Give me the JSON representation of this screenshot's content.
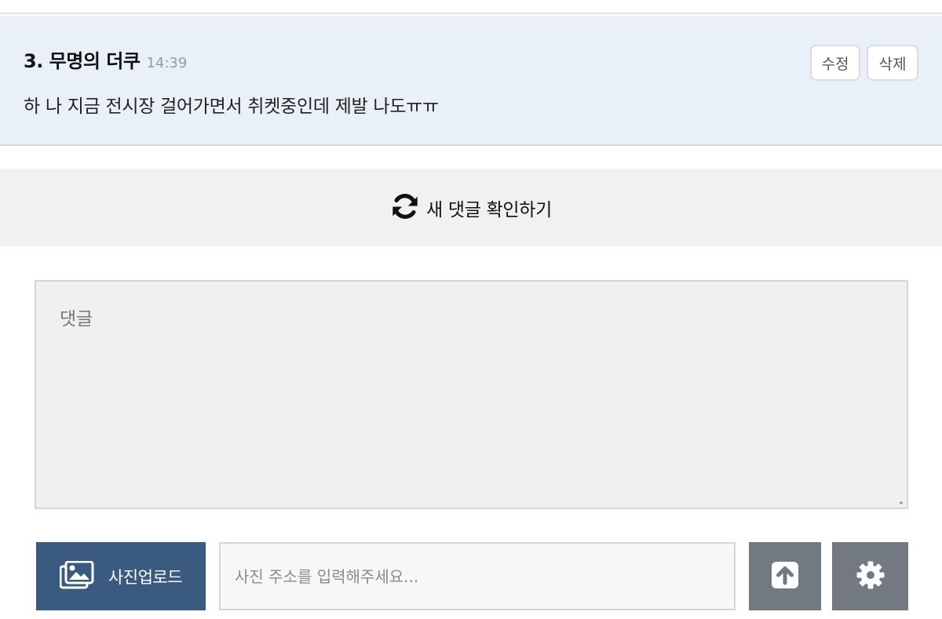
{
  "comment": {
    "author": "3. 무명의 더쿠",
    "time": "14:39",
    "body": "하 나 지금 전시장 걸어가면서 취켓중인데 제발 나도ㅠㅠ",
    "edit_label": "수정",
    "delete_label": "삭제"
  },
  "refresh": {
    "label": "새 댓글 확인하기",
    "icon": "refresh-icon"
  },
  "composer": {
    "placeholder": "댓글",
    "photo_upload_label": "사진업로드",
    "photo_icon": "image-icon",
    "url_placeholder": "사진 주소를 입력해주세요...",
    "upload_icon": "arrow-up-icon",
    "settings_icon": "gear-icon"
  },
  "colors": {
    "comment_bg": "#e9f0f8",
    "refresh_bg": "#f1f1f1",
    "photo_btn_bg": "#3b5a7f",
    "grey_btn_bg": "#727981"
  }
}
